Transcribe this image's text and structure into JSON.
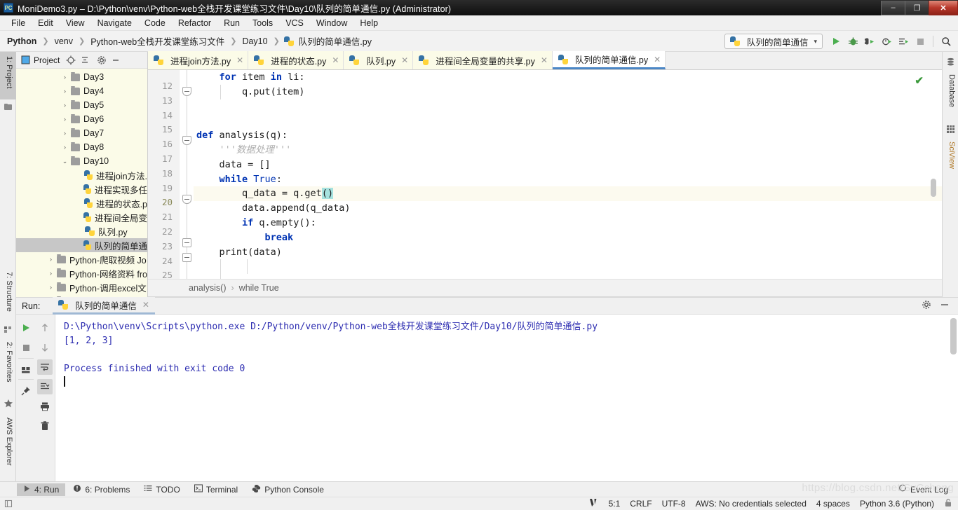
{
  "window": {
    "title": "MoniDemo3.py – D:\\Python\\venv\\Python-web全栈开发课堂练习文件\\Day10\\队列的简单通信.py (Administrator)",
    "app_icon": "pycharm-icon",
    "minimize": "–",
    "restore": "❐",
    "close": "✕"
  },
  "menubar": {
    "items": [
      {
        "label": "File"
      },
      {
        "label": "Edit"
      },
      {
        "label": "View"
      },
      {
        "label": "Navigate"
      },
      {
        "label": "Code"
      },
      {
        "label": "Refactor"
      },
      {
        "label": "Run"
      },
      {
        "label": "Tools"
      },
      {
        "label": "VCS"
      },
      {
        "label": "Window"
      },
      {
        "label": "Help"
      }
    ]
  },
  "breadcrumb": {
    "items": [
      "Python",
      "venv",
      "Python-web全栈开发课堂练习文件",
      "Day10",
      "队列的简单通信.py"
    ],
    "separator": "❯"
  },
  "toolbar": {
    "run_config": "队列的简单通信",
    "run_config_caret": "▾",
    "run_label": "run-button",
    "debug_label": "debug-button",
    "coverage_label": "run-with-coverage-button",
    "profile_label": "profile-button",
    "console_label": "run-console-button",
    "stop_label": "stop-button",
    "search_label": "search-everywhere-button"
  },
  "left_strip": {
    "items": [
      {
        "label": "1: Project",
        "icon": "project-icon",
        "selected": true
      },
      {
        "label": "7: Structure",
        "icon": "structure-icon",
        "selected": false
      },
      {
        "label": "2: Favorites",
        "icon": "star-icon",
        "selected": false
      },
      {
        "label": "AWS Explorer",
        "icon": "cube-icon",
        "selected": false
      }
    ]
  },
  "right_strip": {
    "items": [
      {
        "label": "Database",
        "icon": "database-icon"
      },
      {
        "label": "SciView",
        "icon": "grid-icon"
      }
    ]
  },
  "project": {
    "title": "Project",
    "header_icons": [
      "project-view-icon",
      "locate-icon",
      "collapse-all-icon",
      "settings-icon",
      "hide-icon"
    ],
    "tree": [
      {
        "label": "Day3",
        "type": "folder",
        "indent": 1,
        "arrow": "›",
        "selected": false
      },
      {
        "label": "Day4",
        "type": "folder",
        "indent": 1,
        "arrow": "›",
        "selected": false
      },
      {
        "label": "Day5",
        "type": "folder",
        "indent": 1,
        "arrow": "›",
        "selected": false
      },
      {
        "label": "Day6",
        "type": "folder",
        "indent": 1,
        "arrow": "›",
        "selected": false
      },
      {
        "label": "Day7",
        "type": "folder",
        "indent": 1,
        "arrow": "›",
        "selected": false
      },
      {
        "label": "Day8",
        "type": "folder",
        "indent": 1,
        "arrow": "›",
        "selected": false
      },
      {
        "label": "Day10",
        "type": "folder",
        "indent": 1,
        "arrow": "⌄",
        "selected": false
      },
      {
        "label": "进程join方法.",
        "type": "py",
        "indent": 2,
        "arrow": "",
        "selected": false
      },
      {
        "label": "进程实现多任",
        "type": "py",
        "indent": 2,
        "arrow": "",
        "selected": false
      },
      {
        "label": "进程的状态.p",
        "type": "py",
        "indent": 2,
        "arrow": "",
        "selected": false
      },
      {
        "label": "进程间全局变",
        "type": "py",
        "indent": 2,
        "arrow": "",
        "selected": false
      },
      {
        "label": "队列.py",
        "type": "py",
        "indent": 2,
        "arrow": "",
        "selected": false
      },
      {
        "label": "队列的简单通",
        "type": "py",
        "indent": 2,
        "arrow": "",
        "selected": true
      },
      {
        "label": "Python-爬取视频 Jo",
        "type": "folder",
        "indent": 0,
        "arrow": "›",
        "selected": false
      },
      {
        "label": "Python-网络资料 fro",
        "type": "folder",
        "indent": 0,
        "arrow": "›",
        "selected": false
      },
      {
        "label": "Python-调用excel文",
        "type": "folder",
        "indent": 0,
        "arrow": "›",
        "selected": false
      },
      {
        "label": "Python-爬虫的章.",
        "type": "folder",
        "indent": 0,
        "arrow": "›",
        "selected": false
      }
    ]
  },
  "editor": {
    "tabs": [
      {
        "label": "进程join方法.py",
        "active": false,
        "close": "✕"
      },
      {
        "label": "进程的状态.py",
        "active": false,
        "close": "✕"
      },
      {
        "label": "队列.py",
        "active": false,
        "close": "✕"
      },
      {
        "label": "进程间全局变量的共享.py",
        "active": false,
        "close": "✕"
      },
      {
        "label": "队列的简单通信.py",
        "active": true,
        "close": "✕"
      }
    ],
    "line_numbers": [
      "12",
      "13",
      "14",
      "15",
      "16",
      "17",
      "18",
      "19",
      "20",
      "21",
      "22",
      "23",
      "24",
      "25"
    ],
    "highlighted_line": "20",
    "inspection_status": "✔",
    "breadcrumb": [
      "analysis()",
      "while True"
    ],
    "breadcrumb_sep": "›",
    "code_lines": [
      {
        "n": "12",
        "segments": [
          {
            "t": "    ",
            "c": "plain"
          },
          {
            "t": "for",
            "c": "kw"
          },
          {
            "t": " item ",
            "c": "plain"
          },
          {
            "t": "in",
            "c": "kw"
          },
          {
            "t": " li:",
            "c": "plain"
          }
        ]
      },
      {
        "n": "13",
        "segments": [
          {
            "t": "        q.put(item)",
            "c": "plain"
          }
        ]
      },
      {
        "n": "14",
        "segments": [
          {
            "t": "",
            "c": "plain"
          }
        ]
      },
      {
        "n": "15",
        "segments": [
          {
            "t": "",
            "c": "plain"
          }
        ]
      },
      {
        "n": "16",
        "segments": [
          {
            "t": "def",
            "c": "kw"
          },
          {
            "t": " analysis(q):",
            "c": "plain"
          }
        ]
      },
      {
        "n": "17",
        "segments": [
          {
            "t": "    '''数据处理'''",
            "c": "doc"
          }
        ]
      },
      {
        "n": "18",
        "segments": [
          {
            "t": "    data = []",
            "c": "plain"
          }
        ]
      },
      {
        "n": "19",
        "segments": [
          {
            "t": "    ",
            "c": "plain"
          },
          {
            "t": "while",
            "c": "kw"
          },
          {
            "t": " ",
            "c": "plain"
          },
          {
            "t": "True",
            "c": "kwn"
          },
          {
            "t": ":",
            "c": "plain"
          }
        ]
      },
      {
        "n": "20",
        "segments": [
          {
            "t": "        q_data = q.get",
            "c": "plain"
          },
          {
            "t": "()",
            "c": "sel"
          }
        ]
      },
      {
        "n": "21",
        "segments": [
          {
            "t": "        data.append(q_data)",
            "c": "plain"
          }
        ]
      },
      {
        "n": "22",
        "segments": [
          {
            "t": "        ",
            "c": "plain"
          },
          {
            "t": "if",
            "c": "kw"
          },
          {
            "t": " q.empty():",
            "c": "plain"
          }
        ]
      },
      {
        "n": "23",
        "segments": [
          {
            "t": "            ",
            "c": "plain"
          },
          {
            "t": "break",
            "c": "kw"
          }
        ]
      },
      {
        "n": "24",
        "segments": [
          {
            "t": "    print(data)",
            "c": "plain"
          }
        ]
      },
      {
        "n": "25",
        "segments": [
          {
            "t": "",
            "c": "plain"
          }
        ]
      }
    ]
  },
  "run_window": {
    "label": "Run:",
    "tab": "队列的简单通信",
    "tab_close": "✕",
    "settings_icon": "gear-icon",
    "hide_icon": "hide-icon",
    "toolbar_icons": [
      "rerun-icon",
      "stop-icon",
      "toggle-tasks-icon",
      "pin-icon",
      "up-stack-icon",
      "down-stack-icon",
      "soft-wrap-icon",
      "scroll-to-end-icon",
      "print-icon",
      "clear-all-icon"
    ],
    "console_lines": [
      "D:\\Python\\venv\\Scripts\\python.exe D:/Python/venv/Python-web全栈开发课堂练习文件/Day10/队列的简单通信.py",
      "[1, 2, 3]",
      "",
      "Process finished with exit code 0"
    ],
    "console_color": "#2b2bb0"
  },
  "bottom_tabs": {
    "items": [
      {
        "label": "4: Run",
        "icon": "run-triangle-icon",
        "selected": true
      },
      {
        "label": "6: Problems",
        "icon": "problems-icon",
        "selected": false
      },
      {
        "label": "TODO",
        "icon": "todo-icon",
        "selected": false
      },
      {
        "label": "Terminal",
        "icon": "terminal-icon",
        "selected": false
      },
      {
        "label": "Python Console",
        "icon": "python-icon",
        "selected": false
      }
    ],
    "event_log": "Event Log",
    "event_log_icon": "balloon-icon"
  },
  "statusbar": {
    "left_icon": "toggle-bar-icon",
    "vcs_icon": "vcs-icon",
    "caret": "5:1",
    "line_separator": "CRLF",
    "encoding": "UTF-8",
    "aws": "AWS: No credentials selected",
    "indent": "4 spaces",
    "interpreter": "Python 3.6 (Python)",
    "lock_icon": "lock-icon"
  },
  "watermark": "https://blog.csdn.net/SvCcheng",
  "colors": {
    "accent": "#4c87c6",
    "keyword": "#0033b3",
    "console": "#2b2bb0",
    "selection": "#a6e2df",
    "highlight_line": "#fcfaef",
    "sidebar_bg": "#fbfbe8",
    "ok_green": "#3c9a3c"
  }
}
